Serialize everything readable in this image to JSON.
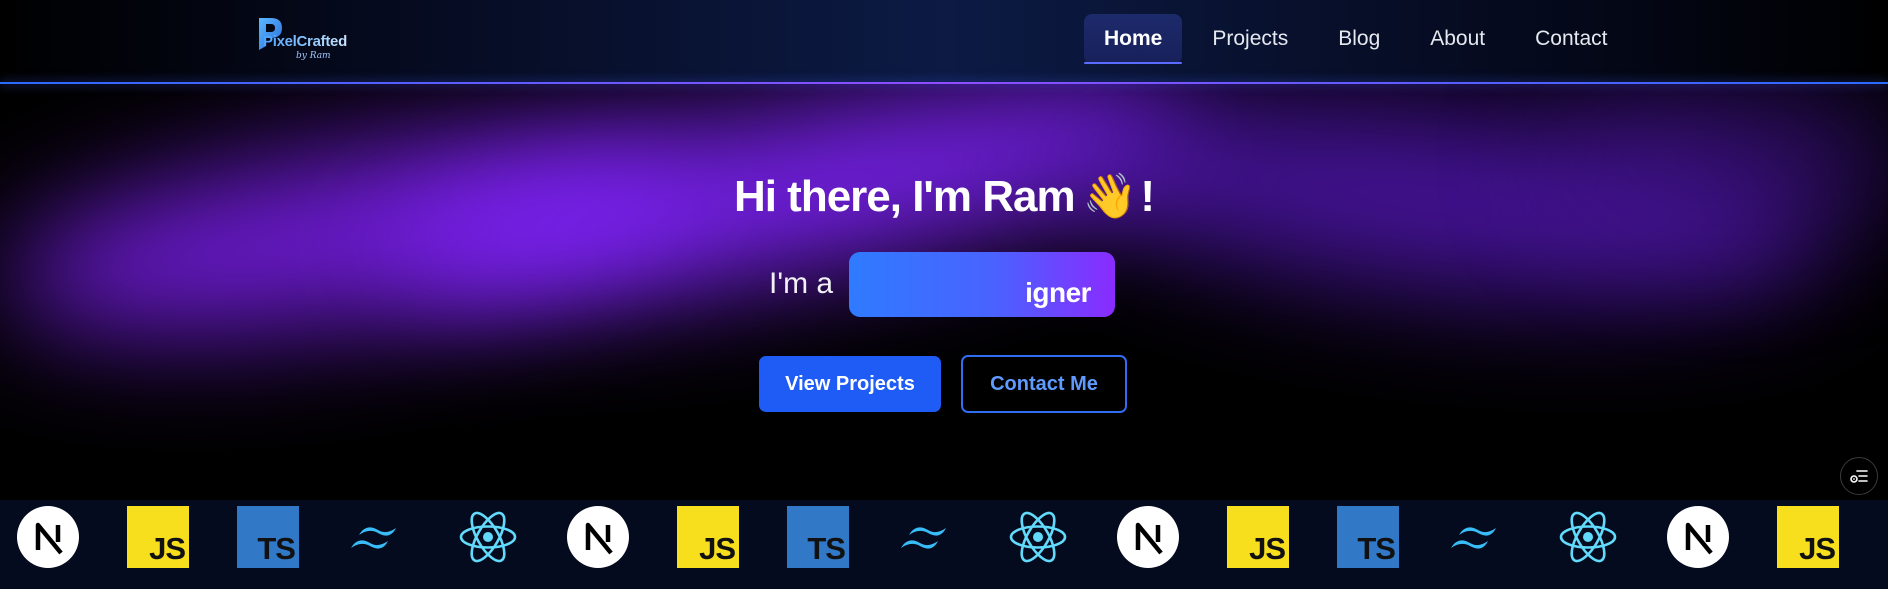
{
  "header": {
    "logo": {
      "name": "PixelCrafted",
      "tagline": "by Ram"
    },
    "nav": [
      {
        "label": "Home",
        "active": true
      },
      {
        "label": "Projects",
        "active": false
      },
      {
        "label": "Blog",
        "active": false
      },
      {
        "label": "About",
        "active": false
      },
      {
        "label": "Contact",
        "active": false
      }
    ]
  },
  "hero": {
    "title": "Hi there, I'm Ram",
    "wave_emoji": "👋",
    "exclaim": "!",
    "role_prefix": "I'm a",
    "role_visible": "igner",
    "buttons": {
      "primary": "View Projects",
      "secondary": "Contact Me"
    }
  },
  "tech_strip": {
    "items": [
      "nextjs-icon",
      "js-icon",
      "ts-icon",
      "tailwind-icon",
      "react-icon",
      "nextjs-icon",
      "js-icon",
      "ts-icon",
      "tailwind-icon",
      "react-icon",
      "nextjs-icon",
      "js-icon",
      "ts-icon",
      "tailwind-icon",
      "react-icon",
      "nextjs-icon",
      "js-icon"
    ],
    "labels": {
      "js": "JS",
      "ts": "TS"
    }
  },
  "colors": {
    "accent_blue": "#1f5bf5",
    "accent_purple": "#8a2bff",
    "header_line": "#8f4dff",
    "strip_bg": "#050b1e"
  },
  "floating_button": {
    "icon": "settings-list-icon"
  }
}
